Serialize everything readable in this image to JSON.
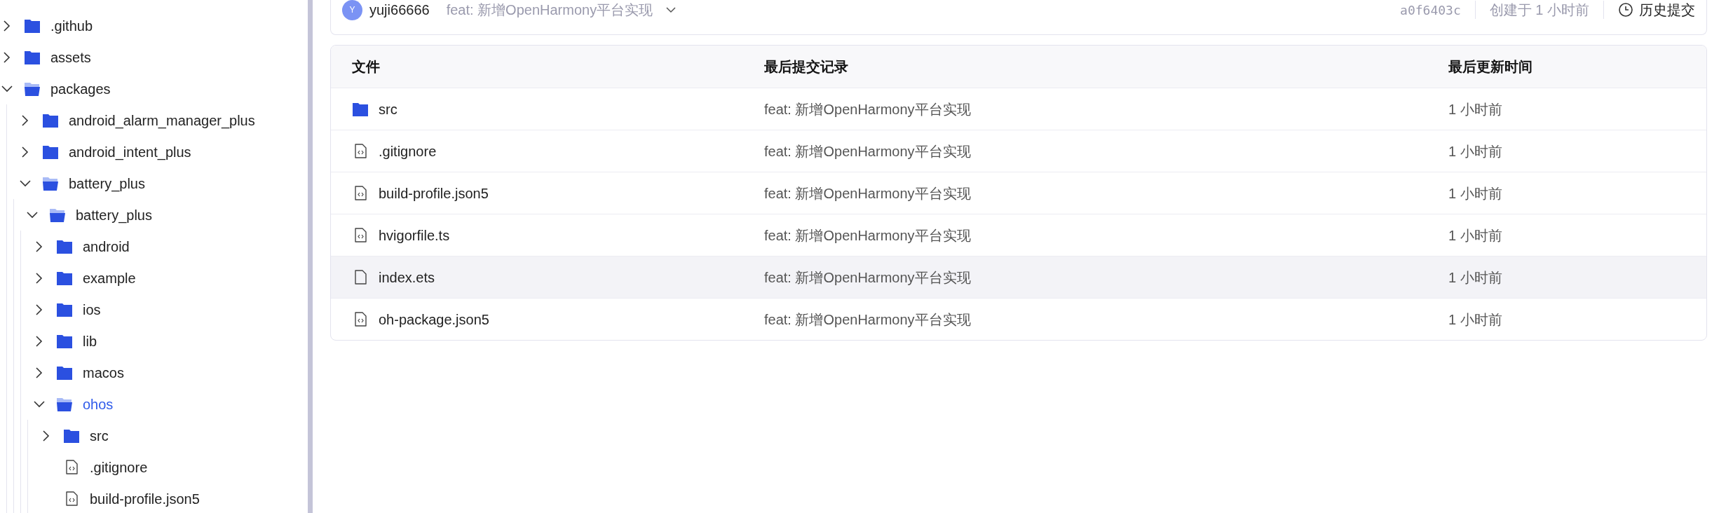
{
  "tree": [
    {
      "name": ".github",
      "kind": "folder",
      "expanded": false,
      "selected": false
    },
    {
      "name": "assets",
      "kind": "folder",
      "expanded": false,
      "selected": false
    },
    {
      "name": "packages",
      "kind": "folder",
      "expanded": true,
      "selected": false,
      "children": [
        {
          "name": "android_alarm_manager_plus",
          "kind": "folder",
          "expanded": false,
          "selected": false
        },
        {
          "name": "android_intent_plus",
          "kind": "folder",
          "expanded": false,
          "selected": false
        },
        {
          "name": "battery_plus",
          "kind": "folder",
          "expanded": true,
          "selected": false,
          "children": [
            {
              "name": "battery_plus",
              "kind": "folder",
              "expanded": true,
              "selected": false,
              "children": [
                {
                  "name": "android",
                  "kind": "folder",
                  "expanded": false,
                  "selected": false
                },
                {
                  "name": "example",
                  "kind": "folder",
                  "expanded": false,
                  "selected": false
                },
                {
                  "name": "ios",
                  "kind": "folder",
                  "expanded": false,
                  "selected": false
                },
                {
                  "name": "lib",
                  "kind": "folder",
                  "expanded": false,
                  "selected": false
                },
                {
                  "name": "macos",
                  "kind": "folder",
                  "expanded": false,
                  "selected": false
                },
                {
                  "name": "ohos",
                  "kind": "folder",
                  "expanded": true,
                  "selected": true,
                  "children": [
                    {
                      "name": "src",
                      "kind": "folder",
                      "expanded": false,
                      "selected": false
                    },
                    {
                      "name": ".gitignore",
                      "kind": "code-file",
                      "selected": false
                    },
                    {
                      "name": "build-profile.json5",
                      "kind": "code-file",
                      "selected": false
                    }
                  ]
                }
              ]
            }
          ]
        }
      ]
    }
  ],
  "commit_bar": {
    "avatar": "Y",
    "author": "yuji66666",
    "message": "feat: 新增OpenHarmony平台实现",
    "hash": "a0f6403c",
    "created": "创建于 1 小时前",
    "history": "历史提交"
  },
  "table": {
    "columns": [
      "文件",
      "最后提交记录",
      "最后更新时间"
    ],
    "rows": [
      {
        "name": "src",
        "kind": "folder",
        "commit": "feat: 新增OpenHarmony平台实现",
        "time": "1 小时前",
        "hovered": false
      },
      {
        "name": ".gitignore",
        "kind": "code-file",
        "commit": "feat: 新增OpenHarmony平台实现",
        "time": "1 小时前",
        "hovered": false
      },
      {
        "name": "build-profile.json5",
        "kind": "code-file",
        "commit": "feat: 新增OpenHarmony平台实现",
        "time": "1 小时前",
        "hovered": false
      },
      {
        "name": "hvigorfile.ts",
        "kind": "code-file",
        "commit": "feat: 新增OpenHarmony平台实现",
        "time": "1 小时前",
        "hovered": false
      },
      {
        "name": "index.ets",
        "kind": "file",
        "commit": "feat: 新增OpenHarmony平台实现",
        "time": "1 小时前",
        "hovered": true
      },
      {
        "name": "oh-package.json5",
        "kind": "code-file",
        "commit": "feat: 新增OpenHarmony平台实现",
        "time": "1 小时前",
        "hovered": false
      }
    ]
  }
}
